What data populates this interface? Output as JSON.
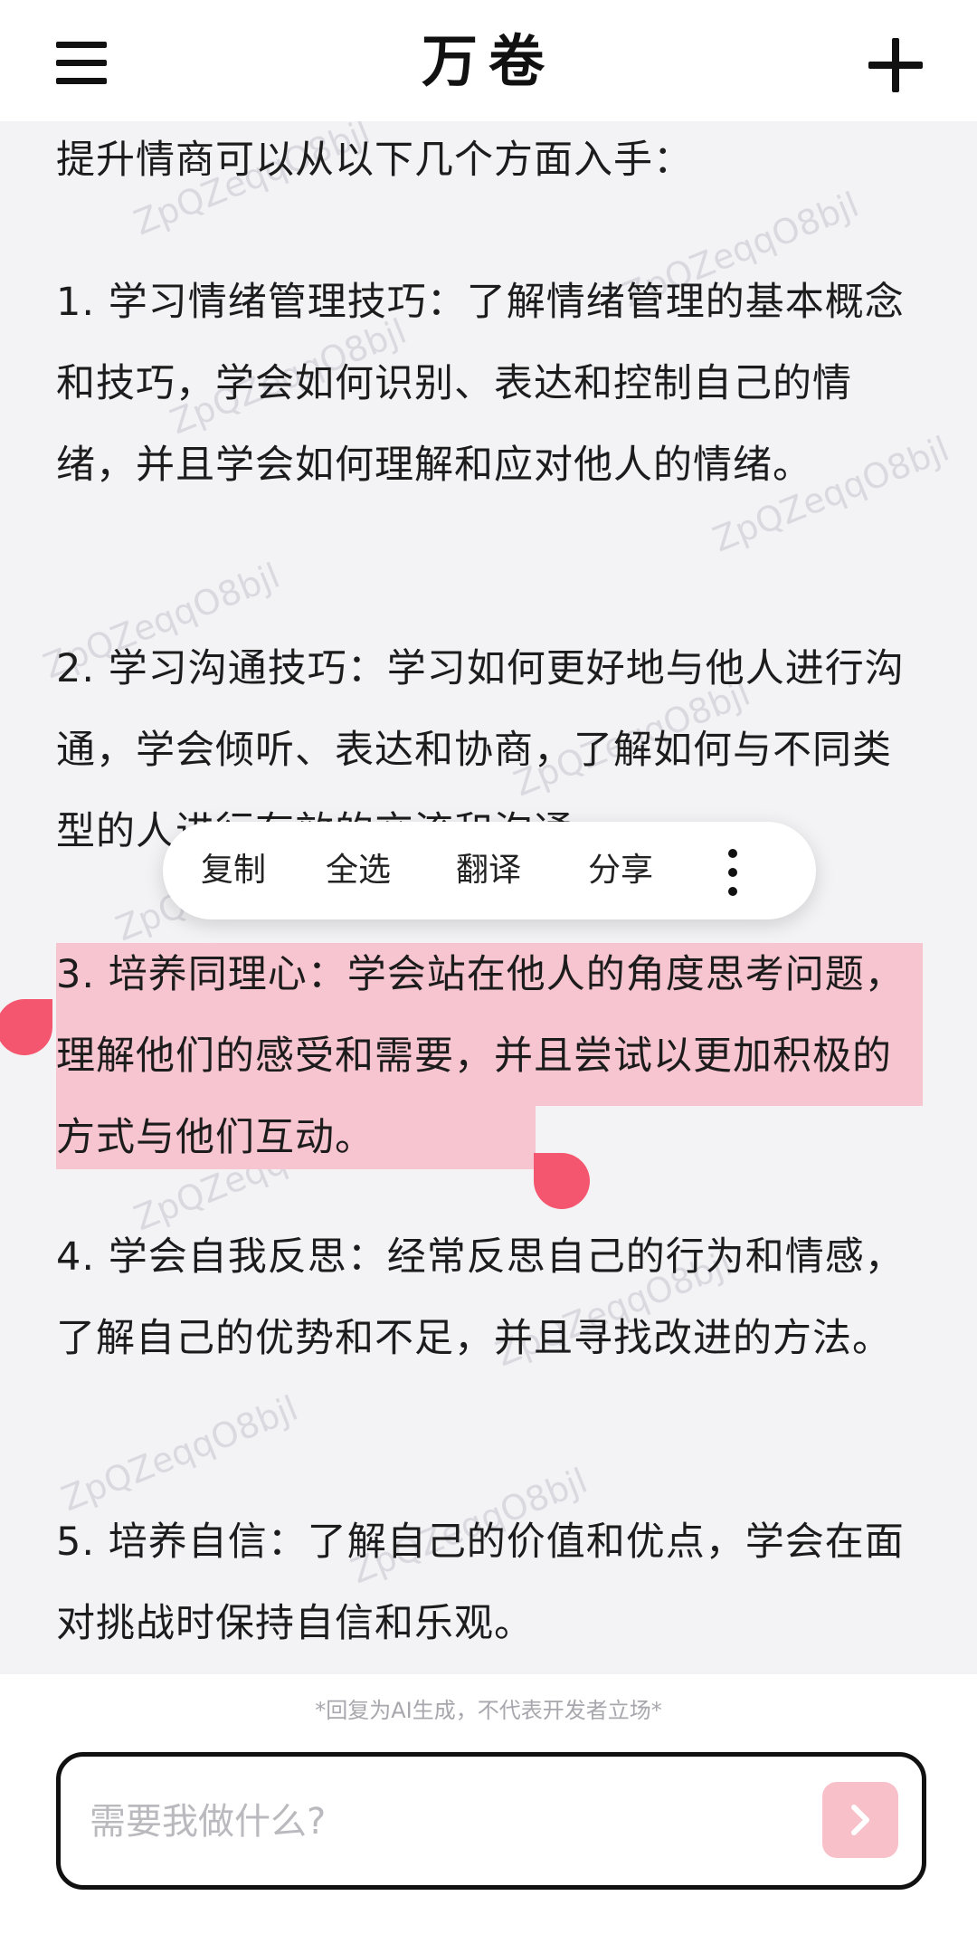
{
  "header": {
    "title": "万卷"
  },
  "content": {
    "paragraphs": [
      "提升情商可以从以下几个方面入手：",
      "1. 学习情绪管理技巧：了解情绪管理的基本概念和技巧，学会如何识别、表达和控制自己的情绪，并且学会如何理解和应对他人的情绪。",
      "2. 学习沟通技巧：学习如何更好地与他人进行沟通，学会倾听、表达和协商，了解如何与不同类型的人进行有效的交流和沟通。",
      "3. 培养同理心：学会站在他人的角度思考问题，理解他们的感受和需要，并且尝试以更加积极的方式与他们互动。",
      "4. 学会自我反思：经常反思自己的行为和情感，了解自己的优势和不足，并且寻找改进的方法。",
      "5. 培养自信：了解自己的价值和优点，学会在面对挑战时保持自信和乐观。"
    ],
    "watermark": "ZpQZeqqO8bjl"
  },
  "context_menu": {
    "copy": "复制",
    "select_all": "全选",
    "translate": "翻译",
    "share": "分享"
  },
  "footer": {
    "disclaimer": "*回复为AI生成，不代表开发者立场*",
    "input_placeholder": "需要我做什么?"
  },
  "colors": {
    "selection": "#f7c5d0",
    "handle": "#f4566f",
    "send_button": "#f8c0c9"
  }
}
